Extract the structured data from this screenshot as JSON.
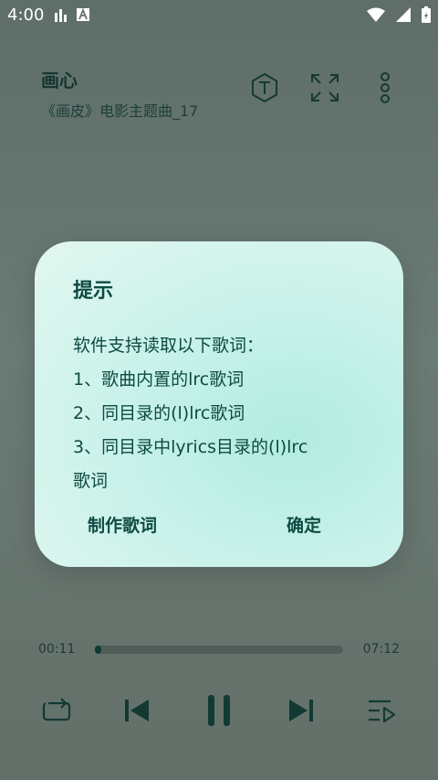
{
  "status_bar": {
    "time": "4:00",
    "icons": [
      "signal-bars-icon",
      "font-a-icon",
      "wifi-icon",
      "cell-signal-icon",
      "battery-charging-icon"
    ]
  },
  "header": {
    "title": "画心",
    "subtitle": "《画皮》电影主题曲_17",
    "actions": [
      "text-t-icon",
      "fullscreen-icon",
      "more-vert-icon"
    ]
  },
  "dialog": {
    "title": "提示",
    "message_lines": [
      "软件支持读取以下歌词：",
      "1、歌曲内置的lrc歌词",
      "2、同目录的(l)lrc歌词",
      "3、同目录中lyrics目录的(l)lrc",
      "歌词"
    ],
    "buttons": {
      "make_lyrics": "制作歌词",
      "confirm": "确定"
    }
  },
  "player": {
    "current_time": "00:11",
    "total_time": "07:12",
    "progress": 0.025
  },
  "controls": [
    "repeat-icon",
    "previous-icon",
    "pause-icon",
    "next-icon",
    "playlist-icon"
  ],
  "colors": {
    "background": "#66756f",
    "dialog_bg": "#c5f1e9",
    "accent_dark": "#0f3b34",
    "text": "#0d4a42"
  }
}
